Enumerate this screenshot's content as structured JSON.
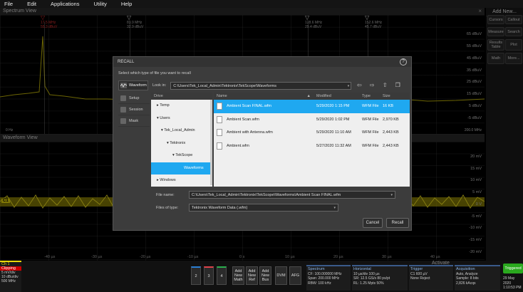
{
  "menu": [
    "File",
    "Edit",
    "Applications",
    "Utility",
    "Help"
  ],
  "spectrum": {
    "title": "Spectrum View",
    "close": "×",
    "dbm_labels": [
      "65 dBuV",
      "55 dBuV",
      "45 dBuV",
      "35 dBuV",
      "25 dBuV",
      "15 dBuV",
      "5 dBuV",
      "-5 dBuV",
      "-15 dBuV",
      "-25 dBuV"
    ],
    "markers": [
      {
        "freq": "17.5 MHz",
        "level": "55.3 dBuV",
        "ref": "R"
      },
      {
        "freq": "83.9 MHz",
        "level": "32.9 dBuV"
      },
      {
        "freq": "128.6 MHz",
        "level": "29.4 dBuV"
      },
      {
        "freq": "152.6 MHz",
        "level": "45.7 dBuV"
      }
    ],
    "start": "0 Hz",
    "stop": "200.0 MHz"
  },
  "waveform": {
    "title": "Waveform View",
    "y_labels": [
      "20 mV",
      "15 mV",
      "10 mV",
      "5 mV",
      "0 V",
      "-5 mV",
      "-10 mV",
      "-15 mV",
      "-20 mV"
    ],
    "x_labels": [
      "-40 µs",
      "-30 µs",
      "-20 µs",
      "-10 µs",
      "0 s",
      "10 µs",
      "20 µs",
      "30 µs",
      "40 µs"
    ],
    "channel_tag": "C1"
  },
  "right_panel": {
    "title": "Add New...",
    "buttons": [
      "Cursors",
      "Callout",
      "Measure",
      "Search",
      "Results Table",
      "Plot",
      "Math",
      "More..."
    ]
  },
  "dialog": {
    "title": "RECALL",
    "help": "?",
    "subtitle": "Select which type of file you want to recall",
    "type_button": "Waveform",
    "look_in_label": "Look in:",
    "look_in_path": "C:\\Users\\Tek_Local_Admin\\Tektronix\\TekScope\\Waveforms",
    "side_items": [
      "Setup",
      "Session",
      "Mask"
    ],
    "drive_header": "Drive",
    "drive_items": [
      {
        "label": "▸ Temp",
        "indent": 0
      },
      {
        "label": "▾ Users",
        "indent": 0
      },
      {
        "label": "▾ Tek_Local_Admin",
        "indent": 1
      },
      {
        "label": "▾ Tektronix",
        "indent": 2
      },
      {
        "label": "▾ TekScope",
        "indent": 3
      },
      {
        "label": "Waveforms",
        "indent": 4,
        "selected": true
      },
      {
        "label": "▸ Windows",
        "indent": 0
      }
    ],
    "columns": [
      "Name",
      "Modified",
      "Type",
      "Size"
    ],
    "files": [
      {
        "name": "Ambient Scan FINAL.wfm",
        "modified": "5/29/2020 1:15 PM",
        "type": "WFM File",
        "size": "16 KB",
        "selected": true
      },
      {
        "name": "Ambient Scan.wfm",
        "modified": "5/29/2020 1:02 PM",
        "type": "WFM File",
        "size": "2,970 KB"
      },
      {
        "name": "Ambient with Antenna.wfm",
        "modified": "5/29/2020 11:10 AM",
        "type": "WFM File",
        "size": "2,443 KB"
      },
      {
        "name": "Ambient.wfm",
        "modified": "5/27/2020 11:32 AM",
        "type": "WFM File",
        "size": "2,443 KB"
      }
    ],
    "file_name_label": "File name:",
    "file_name": "C:\\Users\\Tek_Local_Admin\\Tektronix\\TekScope\\Waveforms\\Ambient Scan FINAL.wfm",
    "file_type_label": "Files of type:",
    "file_type": "Tektronix Waveform Data (.wfm)",
    "cancel": "Cancel",
    "recall": "Recall"
  },
  "bottom": {
    "ch1": {
      "title": "Ch 1",
      "status": "Clipping",
      "lines": [
        "5 mV/div",
        "10 dBu/div",
        "500 MHz"
      ]
    },
    "buttons": [
      "2",
      "3",
      "4",
      "Add New Math",
      "Add New Ref",
      "Add New Bus",
      "DVM",
      "AFG"
    ],
    "spectrum": {
      "title": "Spectrum",
      "lines": [
        "CF: 100.000000 MHz",
        "Span: 200.000 MHz",
        "RBW: 100 kHz"
      ]
    },
    "horizontal": {
      "title": "Horizontal",
      "lines": [
        "10 µs/div   100 µs",
        "SR: 12.5 GS/s   80 ps/pt",
        "RL: 1.25 Mpts   50%"
      ]
    },
    "trigger": {
      "title": "Trigger",
      "lines": [
        "C1   600 µV",
        "None Reject"
      ]
    },
    "acquisition": {
      "title": "Acquisition",
      "lines": [
        "Auto,   Analyze",
        "Sample: 8 bits",
        "2,826 kAcqs"
      ]
    },
    "activate": "Activate",
    "triggered": "Triggered",
    "date": "29 May 2020",
    "time": "1:10:53 PM"
  }
}
